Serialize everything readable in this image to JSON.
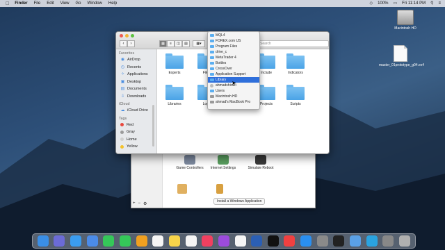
{
  "menubar": {
    "app_name": "Finder",
    "menus": [
      "File",
      "Edit",
      "View",
      "Go",
      "Window",
      "Help"
    ],
    "battery": "100%",
    "clock": "Fri 11:14 PM"
  },
  "desktop": {
    "icons": [
      "Macintosh HD",
      "master_01prototype_g04.ex4"
    ]
  },
  "finder": {
    "search_placeholder": "Search",
    "sidebar": {
      "favorites_header": "Favorites",
      "favorites": [
        "AirDrop",
        "Recents",
        "Applications",
        "Desktop",
        "Documents",
        "Downloads"
      ],
      "icloud_header": "iCloud",
      "icloud": [
        "iCloud Drive"
      ],
      "tags_header": "Tags",
      "tags": [
        {
          "label": "Red",
          "color": "#e8483d"
        },
        {
          "label": "Gray",
          "color": "#9a9a9a"
        },
        {
          "label": "Home",
          "color": "#cfcfcf"
        },
        {
          "label": "Yellow",
          "color": "#f4c22b"
        }
      ]
    },
    "folders_row1": [
      "Experts",
      "Files",
      "Include",
      "Indicators"
    ],
    "folders_row2": [
      "Libraries",
      "Logs",
      "Projects",
      "Scripts"
    ]
  },
  "path_menu": {
    "items": [
      {
        "label": "MQL4",
        "icon": "folder"
      },
      {
        "label": "FOREX.com US",
        "icon": "folder"
      },
      {
        "label": "Program Files",
        "icon": "folder"
      },
      {
        "label": "drive_c",
        "icon": "folder"
      },
      {
        "label": "MetaTrader 4",
        "icon": "folder"
      },
      {
        "label": "Bottles",
        "icon": "folder"
      },
      {
        "label": "CrossOver",
        "icon": "folder"
      },
      {
        "label": "Application Support",
        "icon": "folder"
      },
      {
        "label": "Library",
        "icon": "folder"
      },
      {
        "label": "ahmadshirazi",
        "icon": "user"
      },
      {
        "label": "Users",
        "icon": "folder"
      },
      {
        "label": "Macintosh HD",
        "icon": "disk"
      },
      {
        "label": "ahmad's MacBook Pro",
        "icon": "computer"
      }
    ],
    "selected_index": 8
  },
  "crossover_window": {
    "items": [
      "Game Controllers",
      "Internet Settings",
      "Simulate Reboot"
    ],
    "install_button": "Install a Windows Application"
  },
  "dock": {
    "apps": [
      "Finder",
      "Siri",
      "Safari",
      "Mail",
      "Messages",
      "FaceTime",
      "Photos",
      "Calendar",
      "Notes",
      "Reminders",
      "Music",
      "Podcasts",
      "Chrome",
      "Word",
      "TV",
      "News",
      "App Store",
      "System Preferences",
      "Terminal",
      "Preview",
      "Telegram",
      "Screenshot",
      "Trash"
    ],
    "colors": [
      "#3a8ee6",
      "#6b6bd6",
      "#3a9cf0",
      "#4b8be8",
      "#35c759",
      "#35c759",
      "#f0a020",
      "#f5f5f5",
      "#f7d44a",
      "#f5f5f5",
      "#f04060",
      "#9b4bdc",
      "#f5f5f5",
      "#2b5fb4",
      "#111111",
      "#f04040",
      "#2a8ff0",
      "#8a8a8a",
      "#222222",
      "#5aa0e6",
      "#2aa3e0",
      "#888888",
      "#b0b0b0"
    ]
  }
}
